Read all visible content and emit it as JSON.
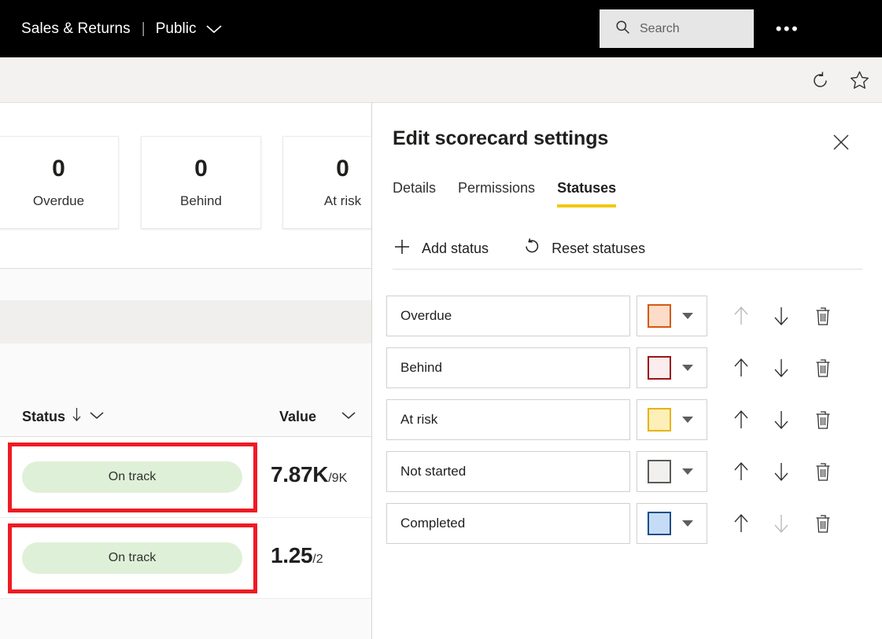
{
  "topbar": {
    "brand_title": "Sales & Returns",
    "separator": "|",
    "workspace": "Public",
    "workspace_chevron_icon": "chevron-down-icon",
    "search_placeholder": "Search",
    "search_icon": "search-icon",
    "more_label": "•••"
  },
  "subbar": {
    "refresh_icon": "refresh-icon",
    "favorite_icon": "star-icon"
  },
  "report": {
    "kpi_cards": [
      {
        "value": "0",
        "label": "Overdue"
      },
      {
        "value": "0",
        "label": "Behind"
      },
      {
        "value": "0",
        "label": "At risk"
      }
    ],
    "table": {
      "columns": [
        {
          "label": "Status",
          "sort_icon": "arrow-down-icon",
          "menu_icon": "chevron-down-icon"
        },
        {
          "label": "Value",
          "menu_icon": "chevron-down-icon"
        }
      ],
      "rows": [
        {
          "status": "On track",
          "status_color": "#dff0d8",
          "value_main": "7.87K",
          "value_sub": "/9K",
          "highlighted": true
        },
        {
          "status": "On track",
          "status_color": "#dff0d8",
          "value_main": "1.25",
          "value_sub": "/2",
          "highlighted": true
        }
      ],
      "highlight_color": "#ee1b24"
    }
  },
  "panel": {
    "title": "Edit scorecard settings",
    "close_icon": "close-icon",
    "tabs": [
      {
        "label": "Details",
        "active": false
      },
      {
        "label": "Permissions",
        "active": false
      },
      {
        "label": "Statuses",
        "active": true
      }
    ],
    "tab_accent_color": "#f2c811",
    "commands": [
      {
        "label": "Add status",
        "icon": "plus-icon"
      },
      {
        "label": "Reset statuses",
        "icon": "reset-icon"
      }
    ],
    "statuses": [
      {
        "name": "Overdue",
        "fill": "#fcdcc8",
        "border": "#d4590f",
        "move_up_enabled": false,
        "move_down_enabled": true
      },
      {
        "name": "Behind",
        "fill": "#fbeced",
        "border": "#9b1515",
        "move_up_enabled": true,
        "move_down_enabled": true
      },
      {
        "name": "At risk",
        "fill": "#fdefb8",
        "border": "#e8b411",
        "move_up_enabled": true,
        "move_down_enabled": true
      },
      {
        "name": "Not started",
        "fill": "#f1f0ee",
        "border": "#5d5a57",
        "move_up_enabled": true,
        "move_down_enabled": true
      },
      {
        "name": "Completed",
        "fill": "#c6dcf6",
        "border": "#1a4f86",
        "move_up_enabled": true,
        "move_down_enabled": false
      }
    ],
    "row_icons": {
      "move_up_icon": "arrow-up-icon",
      "move_down_icon": "arrow-down-icon",
      "delete_icon": "trash-icon",
      "color_caret_icon": "caret-down-icon"
    }
  }
}
